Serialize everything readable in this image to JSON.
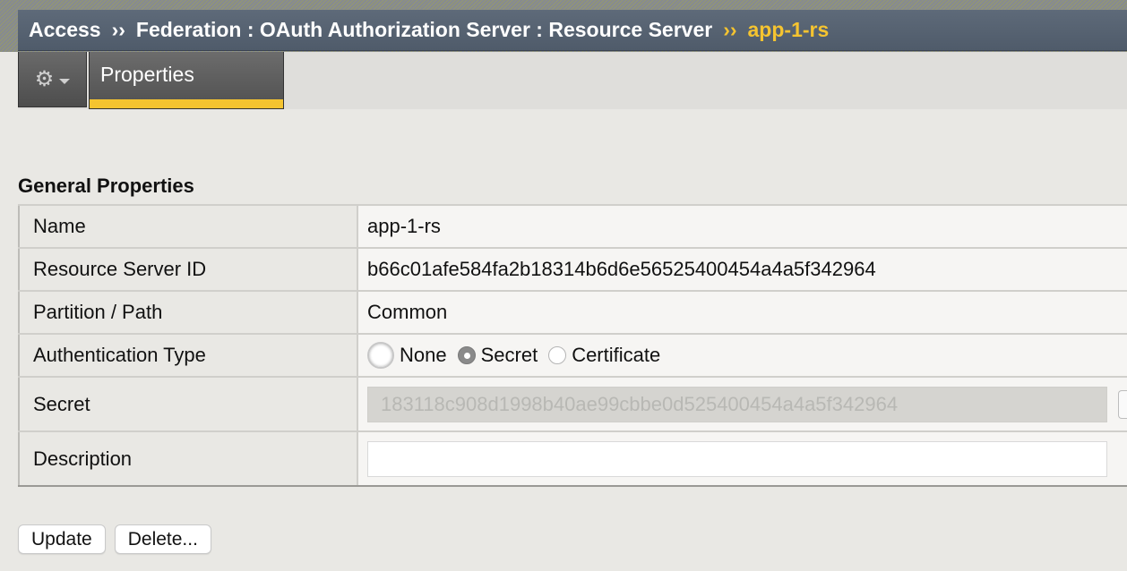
{
  "breadcrumb": {
    "items": [
      "Access",
      "Federation : OAuth Authorization Server : Resource Server"
    ],
    "separator": "››",
    "current": "app-1-rs"
  },
  "tabs": {
    "gear_icon": "gear-icon",
    "active_tab": "Properties"
  },
  "section": {
    "title": "General Properties"
  },
  "form": {
    "name": {
      "label": "Name",
      "value": "app-1-rs"
    },
    "resource_server_id": {
      "label": "Resource Server ID",
      "value": "b66c01afe584fa2b18314b6d6e56525400454a4a5f342964"
    },
    "partition_path": {
      "label": "Partition / Path",
      "value": "Common"
    },
    "auth_type": {
      "label": "Authentication Type",
      "options": [
        "None",
        "Secret",
        "Certificate"
      ],
      "selected": "Secret"
    },
    "secret": {
      "label": "Secret",
      "value": "183118c908d1998b40ae99cbbe0d525400454a4a5f342964"
    },
    "description": {
      "label": "Description",
      "value": ""
    }
  },
  "actions": {
    "update_label": "Update",
    "delete_label": "Delete..."
  },
  "colors": {
    "accent": "#f5c430",
    "header_bg": "#56626f"
  }
}
